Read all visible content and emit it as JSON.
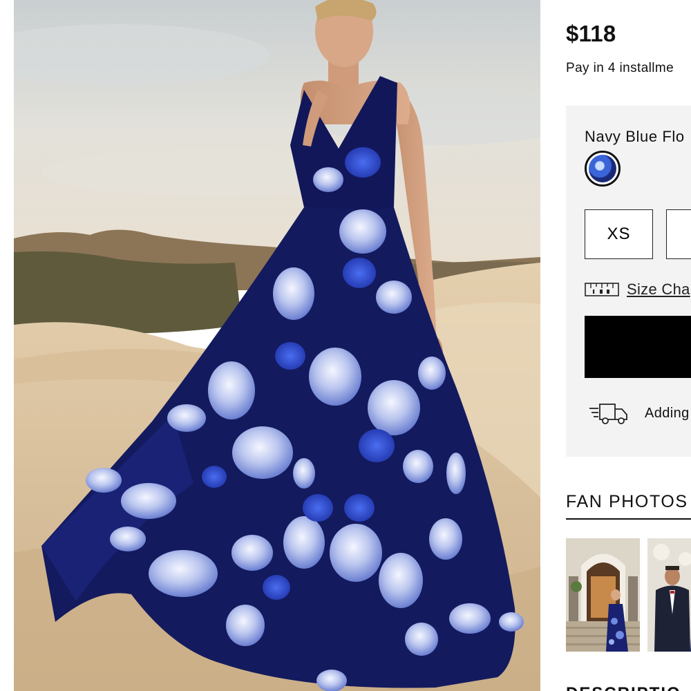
{
  "product": {
    "image_alt": "Navy blue floral print maxi dress worn on sand dunes",
    "price": "$118",
    "installments_text": "Pay in 4 installme"
  },
  "options": {
    "color_name": "Navy Blue Flo",
    "sizes": [
      "XS",
      ""
    ],
    "size_chart_label": "Size Cha",
    "add_to_bag_label": "",
    "delivery_text": "Adding"
  },
  "fan_photos": {
    "title": "FAN PHOTOS"
  },
  "description": {
    "heading": "DESCRIPTIO"
  },
  "colors": {
    "accent": "#000000",
    "panel_bg": "#f3f3f3",
    "swatch_navy": "#1b2a78",
    "swatch_blue": "#3a64d8"
  },
  "icons": [
    "ruler-icon",
    "delivery-truck-icon"
  ]
}
